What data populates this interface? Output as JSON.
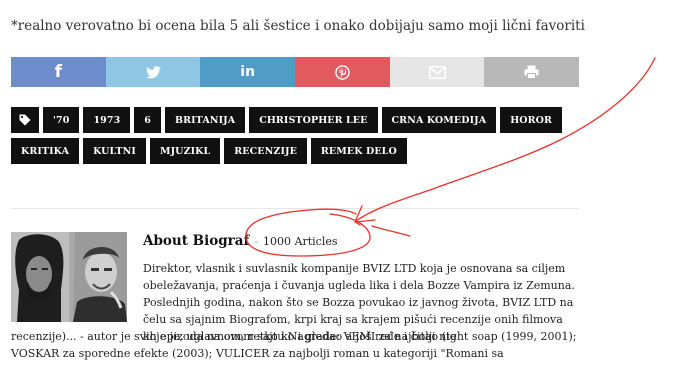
{
  "footnote": "*realno verovatno bi ocena bila 5 ali šestice i onako dobijaju samo moji lični favoriti",
  "share_buttons": [
    {
      "icon": "facebook-icon",
      "color": "#6d8ccc"
    },
    {
      "icon": "twitter-icon",
      "color": "#8ec6e4"
    },
    {
      "icon": "linkedin-icon",
      "color": "#4f9cc6"
    },
    {
      "icon": "pinterest-icon",
      "color": "#e2595f"
    },
    {
      "icon": "mail-icon",
      "color": "#e6e6e6"
    },
    {
      "icon": "print-icon",
      "color": "#b8b8b8"
    }
  ],
  "share_labels": {
    "facebook": "f",
    "linkedin": "in"
  },
  "tags": [
    "'70",
    "1973",
    "6",
    "BRITANIJA",
    "CHRISTOPHER LEE",
    "CRNA KOMEDIJA",
    "HOROR",
    "KRITIKA",
    "KULTNI",
    "MJUZIKL",
    "RECENZIJE",
    "REMEK DELO"
  ],
  "author": {
    "name": "About Biograf",
    "separator": "-",
    "articles": "1000 Articles",
    "bio_top": "Direktor, vlasnik i suvlasnik kompanije BVIZ LTD koja je osnovana sa ciljem obeležavanja, praćenja i čuvanja ugleda lika i dela Bozze Vampira iz Zemuna. Poslednjih godina, nakon što se Bozza povukao iz javnog života, BVIZ LTD na čelu sa sjajnim Biografom, krpi kraj sa krajem pišući recenzije onih filmova koje je, uglavnom, retko ko i gledao a još ređe i čitao (te",
    "bio_bottom": "recenzije)... - autor je svih epizoda na ovom sajtu Nagrade: VEMI za najbolji night soap (1999, 2001); VOSKAR za sporedne efekte (2003); VULICER za najbolji roman u kategoriji \"Romani sa"
  },
  "annotation_color": "#e8312a"
}
